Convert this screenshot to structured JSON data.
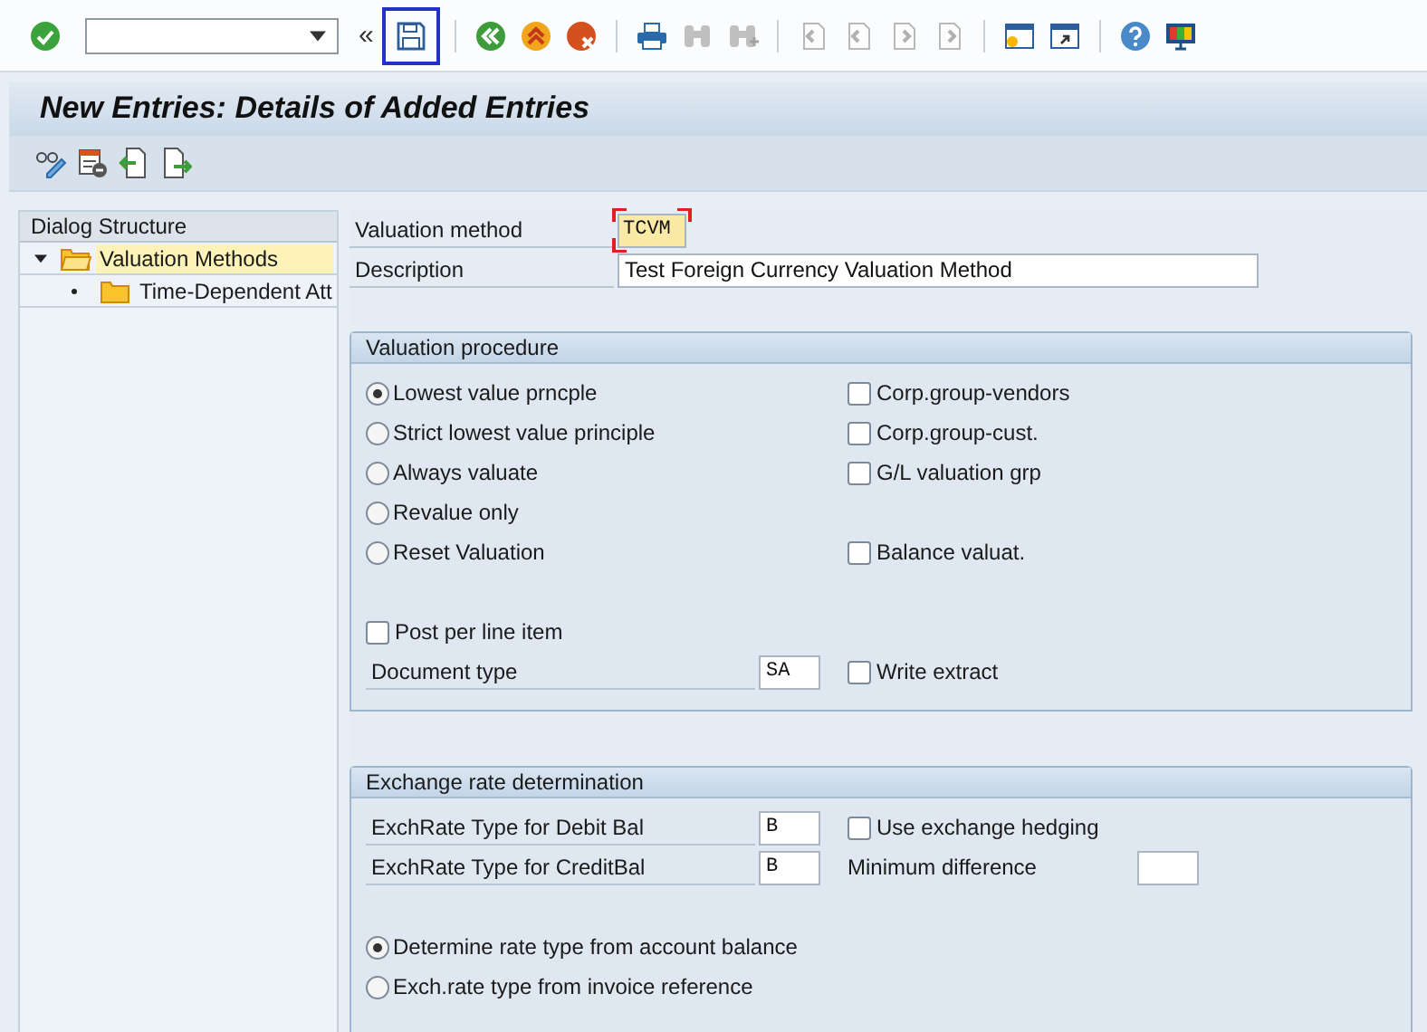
{
  "toolbar": {
    "items": [
      {
        "kind": "ok",
        "disabled": false,
        "highlighted": false
      },
      {
        "kind": "command_field"
      },
      {
        "kind": "collapse",
        "label": "«"
      },
      {
        "kind": "save",
        "disabled": false,
        "highlighted": true
      },
      {
        "kind": "separator"
      },
      {
        "kind": "back",
        "disabled": false,
        "highlighted": false
      },
      {
        "kind": "exit",
        "disabled": false,
        "highlighted": false
      },
      {
        "kind": "cancel",
        "disabled": false,
        "highlighted": false
      },
      {
        "kind": "separator"
      },
      {
        "kind": "print",
        "disabled": false,
        "highlighted": false
      },
      {
        "kind": "find",
        "disabled": true,
        "highlighted": false
      },
      {
        "kind": "find_next",
        "disabled": true,
        "highlighted": false
      },
      {
        "kind": "separator"
      },
      {
        "kind": "first_page",
        "disabled": true,
        "highlighted": false
      },
      {
        "kind": "previous_page",
        "disabled": true,
        "highlighted": false
      },
      {
        "kind": "next_page",
        "disabled": true,
        "highlighted": false
      },
      {
        "kind": "last_page",
        "disabled": true,
        "highlighted": false
      },
      {
        "kind": "separator"
      },
      {
        "kind": "new_session",
        "disabled": false,
        "highlighted": false
      },
      {
        "kind": "shortcut",
        "disabled": false,
        "highlighted": false
      },
      {
        "kind": "separator"
      },
      {
        "kind": "help",
        "disabled": false,
        "highlighted": false
      },
      {
        "kind": "layout",
        "disabled": false,
        "highlighted": false
      }
    ]
  },
  "title": "New Entries: Details of Added Entries",
  "dialog_structure": {
    "title": "Dialog Structure",
    "items": [
      {
        "label": "Valuation Methods",
        "expanded": true,
        "selected": true,
        "children": [
          {
            "label": "Time-Dependent Att",
            "selected": false
          }
        ]
      }
    ]
  },
  "header_fields": [
    {
      "label": "Valuation method",
      "value": "TCVM",
      "focused": true,
      "wide": false
    },
    {
      "label": "Description",
      "value": "Test Foreign Currency Valuation Method",
      "focused": false,
      "wide": true
    }
  ],
  "groups": [
    {
      "title": "Valuation procedure",
      "rows": [
        {
          "kind": "cells",
          "left": {
            "kind": "radio",
            "label": "Lowest value prncple",
            "selected": true
          },
          "right": {
            "kind": "checkbox",
            "label": "Corp.group-vendors",
            "checked": false
          }
        },
        {
          "kind": "cells",
          "left": {
            "kind": "radio",
            "label": "Strict lowest value principle",
            "selected": false
          },
          "right": {
            "kind": "checkbox",
            "label": "Corp.group-cust.",
            "checked": false
          }
        },
        {
          "kind": "cells",
          "left": {
            "kind": "radio",
            "label": "Always valuate",
            "selected": false
          },
          "right": {
            "kind": "checkbox",
            "label": "G/L valuation grp",
            "checked": false
          }
        },
        {
          "kind": "cells",
          "left": {
            "kind": "radio",
            "label": "Revalue only",
            "selected": false
          }
        },
        {
          "kind": "cells",
          "left": {
            "kind": "radio",
            "label": "Reset Valuation",
            "selected": false
          },
          "right": {
            "kind": "checkbox",
            "label": "Balance valuat.",
            "checked": false
          }
        },
        {
          "kind": "spacer"
        },
        {
          "kind": "cells",
          "left": {
            "kind": "checkbox",
            "label": "Post per line item",
            "checked": false
          }
        },
        {
          "kind": "cells",
          "left": {
            "kind": "field",
            "label": "Document type",
            "value": "SA"
          },
          "right": {
            "kind": "checkbox",
            "label": "Write extract",
            "checked": false
          }
        }
      ]
    },
    {
      "title": "Exchange rate determination",
      "rows": [
        {
          "kind": "cells",
          "left": {
            "kind": "field",
            "label": "ExchRate Type for Debit Bal",
            "value": "B"
          },
          "right": {
            "kind": "checkbox",
            "label": "Use exchange hedging",
            "checked": false
          }
        },
        {
          "kind": "cells",
          "left": {
            "kind": "field",
            "label": "ExchRate Type for CreditBal",
            "value": "B"
          },
          "right": {
            "kind": "plain_field",
            "label": "Minimum difference"
          }
        },
        {
          "kind": "spacer"
        },
        {
          "kind": "cells",
          "left": {
            "kind": "radio",
            "label": "Determine rate type from account balance",
            "selected": true
          }
        },
        {
          "kind": "cells",
          "left": {
            "kind": "radio",
            "label": "Exch.rate type from invoice reference",
            "selected": false
          }
        }
      ]
    }
  ]
}
